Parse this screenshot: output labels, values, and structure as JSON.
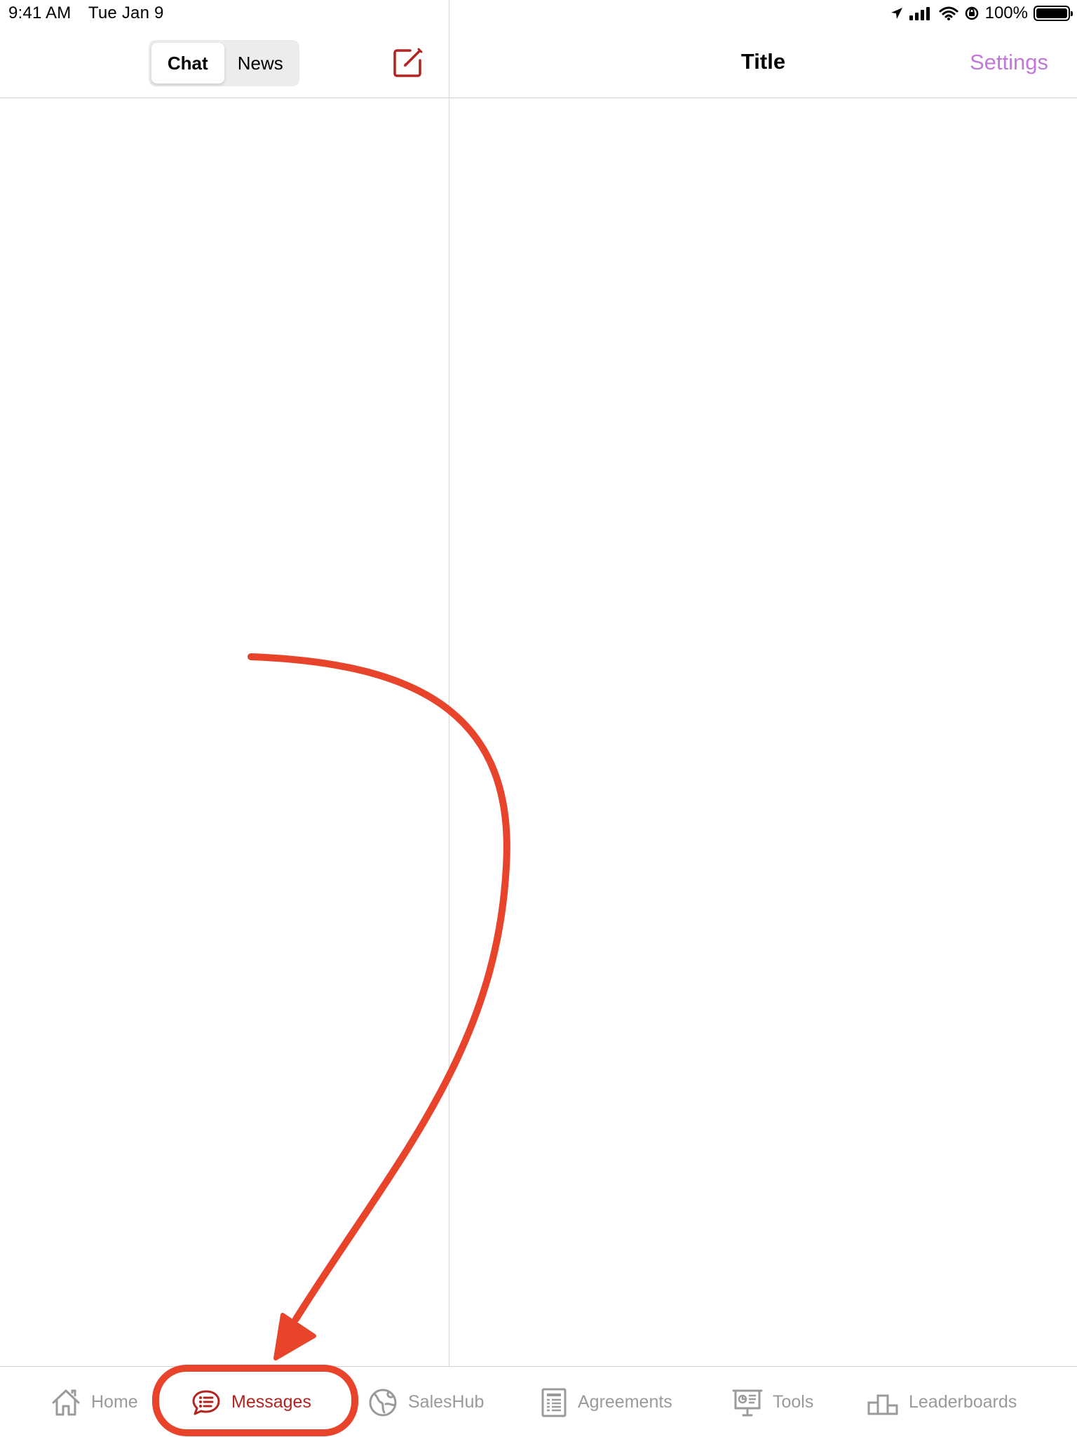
{
  "status_bar": {
    "time": "9:41 AM",
    "date": "Tue Jan 9",
    "battery": "100%"
  },
  "left_pane": {
    "segments": [
      {
        "label": "Chat",
        "selected": true
      },
      {
        "label": "News",
        "selected": false
      }
    ],
    "compose_icon": "compose-icon"
  },
  "right_pane": {
    "title": "Title",
    "settings_label": "Settings"
  },
  "tab_bar": {
    "tabs": [
      {
        "label": "Home",
        "icon": "home-icon"
      },
      {
        "label": "Messages",
        "icon": "chat-bubble-icon",
        "selected": true
      },
      {
        "label": "SalesHub",
        "icon": "globe-icon"
      },
      {
        "label": "Agreements",
        "icon": "document-icon"
      },
      {
        "label": "Tools",
        "icon": "presentation-board-icon"
      },
      {
        "label": "Leaderboards",
        "icon": "podium-icon"
      }
    ]
  },
  "colors": {
    "accent": "#b3231f",
    "settings": "#c178d9",
    "annotation": "#e8432b",
    "inactive_tab": "#9a9a9a"
  }
}
